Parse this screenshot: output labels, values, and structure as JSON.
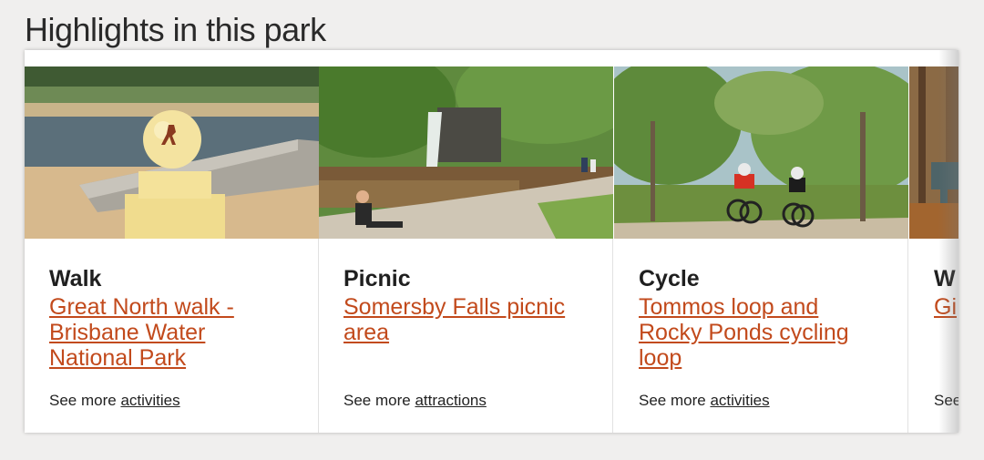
{
  "heading": "Highlights in this park",
  "cards": [
    {
      "category": "Walk",
      "title": "Great North walk - Brisbane Water National Park",
      "more_prefix": "See more",
      "more_link": "activities",
      "image_icon": "walking-trail-marker-photo"
    },
    {
      "category": "Picnic",
      "title": "Somersby Falls picnic area",
      "more_prefix": "See more",
      "more_link": "attractions",
      "image_icon": "waterfall-pool-photo"
    },
    {
      "category": "Cycle",
      "title": "Tommos loop and Rocky Ponds cycling loop",
      "more_prefix": "See more",
      "more_link": "activities",
      "image_icon": "mountain-bikers-photo"
    },
    {
      "category": "W",
      "title": "Gi",
      "more_prefix": "See",
      "more_link": "",
      "image_icon": "signpost-forest-photo"
    }
  ]
}
